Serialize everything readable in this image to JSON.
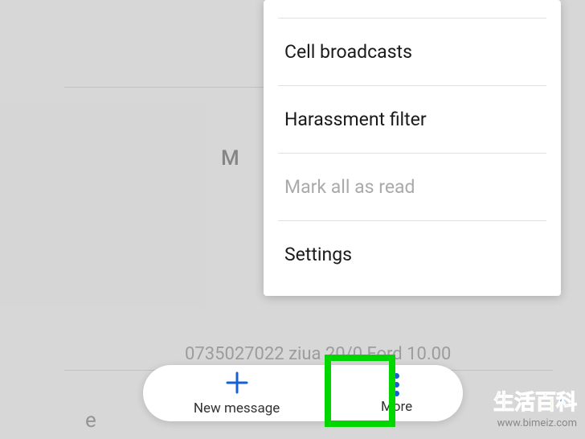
{
  "background": {
    "partial_letters": {
      "m": "M",
      "e": "e"
    },
    "phone_snippet": "0735027022 ziua 20/0 Ford 10.00"
  },
  "menu": {
    "items": [
      {
        "label": "Cell broadcasts",
        "disabled": false
      },
      {
        "label": "Harassment filter",
        "disabled": false
      },
      {
        "label": "Mark all as read",
        "disabled": true
      },
      {
        "label": "Settings",
        "disabled": false
      }
    ]
  },
  "bottom_bar": {
    "new_message": "New message",
    "more": "More"
  },
  "highlight": {
    "color": "#00d600"
  },
  "watermark": {
    "chinese": "生活百科",
    "url": "www.bimeiz.com"
  }
}
